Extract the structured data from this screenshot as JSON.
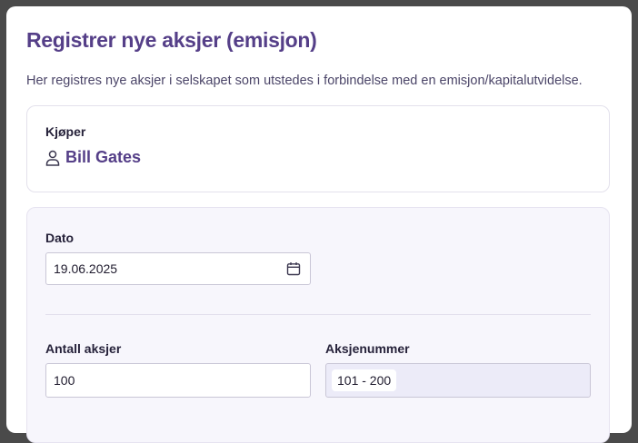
{
  "dialog": {
    "title": "Registrer nye aksjer (emisjon)",
    "description": "Her registres nye aksjer i selskapet som utstedes i forbindelse med en emisjon/kapitalutvidelse."
  },
  "buyer": {
    "label": "Kjøper",
    "icon": "user-icon",
    "name": "Bill Gates"
  },
  "form": {
    "date": {
      "label": "Dato",
      "value": "19.06.2025",
      "icon": "calendar-icon"
    },
    "share_count": {
      "label": "Antall aksjer",
      "value": "100"
    },
    "share_numbers": {
      "label": "Aksjenummer",
      "value": "101 - 200"
    }
  },
  "colors": {
    "accent": "#553f88",
    "panel_bg": "#f7f6fc",
    "readonly_bg": "#ecebf8"
  }
}
